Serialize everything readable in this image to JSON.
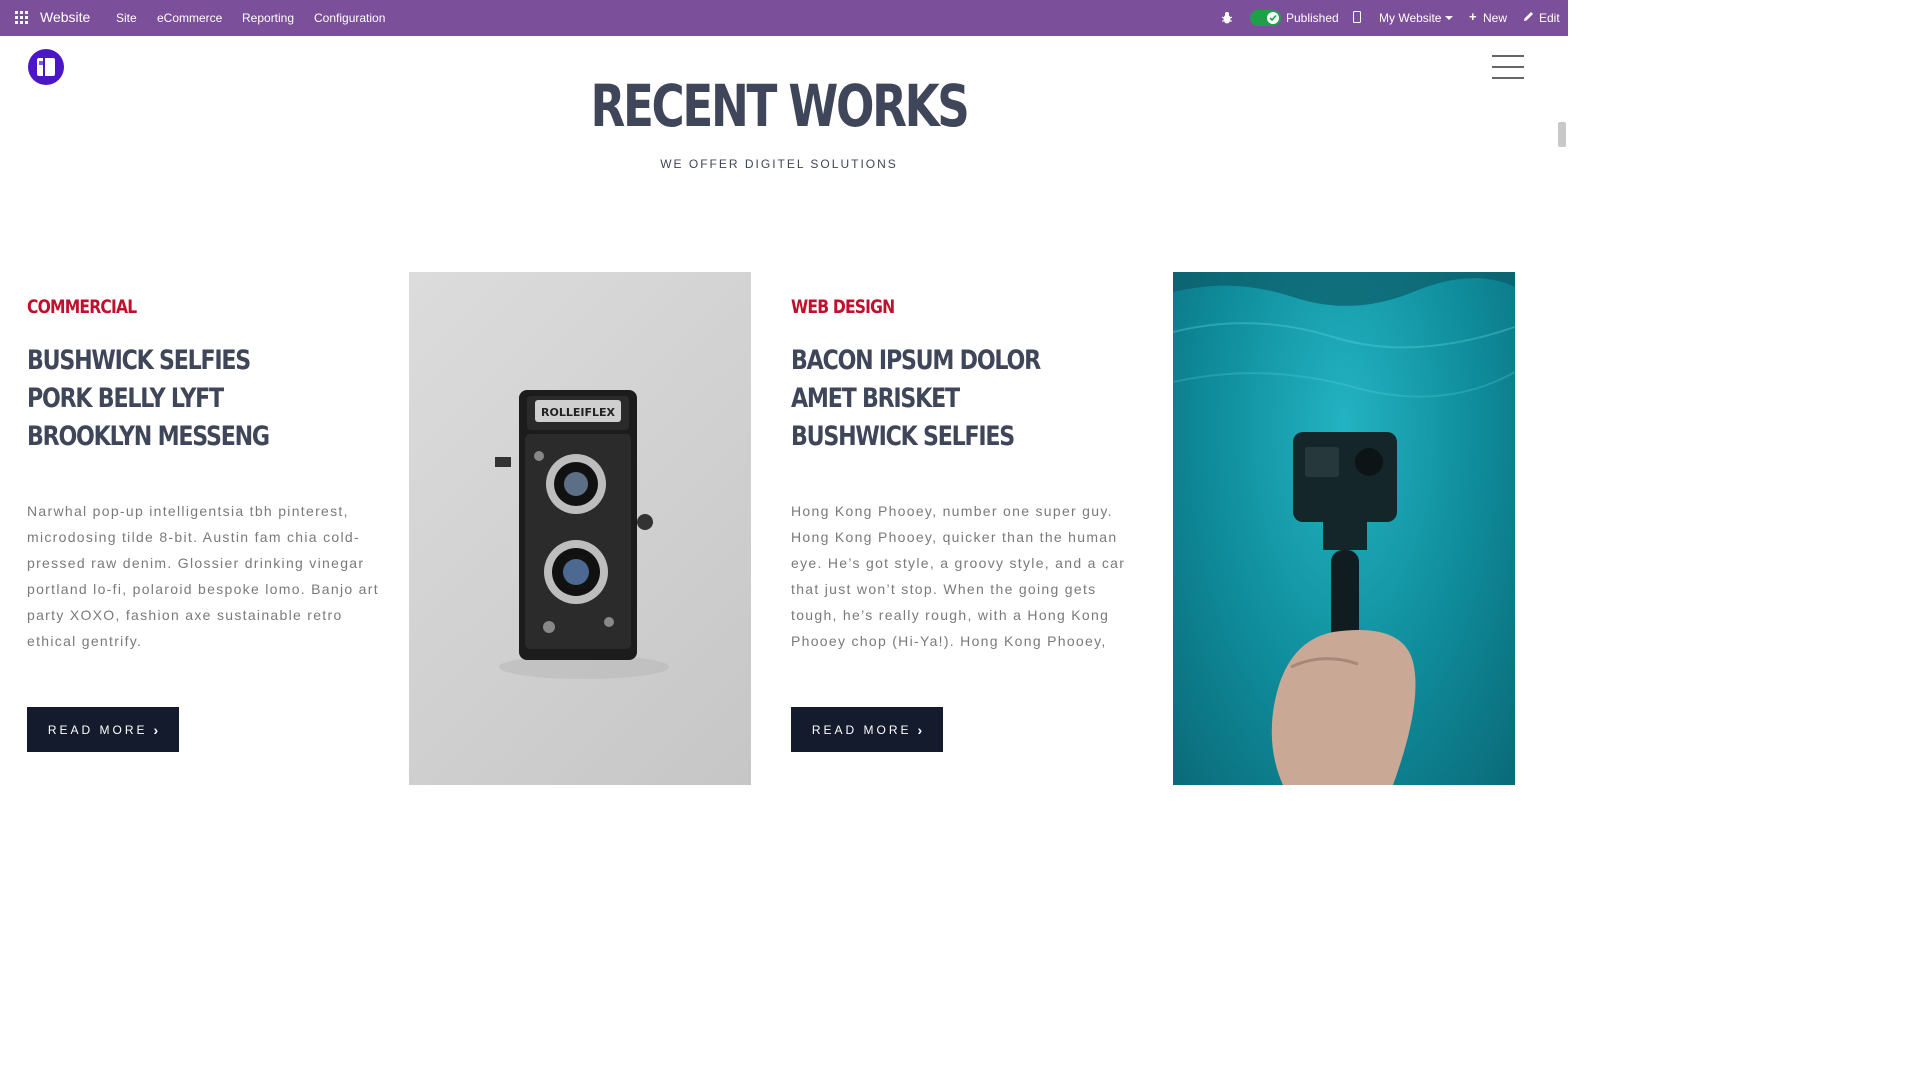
{
  "topbar": {
    "brand": "Website",
    "menu": [
      "Site",
      "eCommerce",
      "Reporting",
      "Configuration"
    ],
    "published_label": "Published",
    "site_selector": "My Website",
    "new_label": "New",
    "edit_label": "Edit",
    "bar_color": "#7c4f9a",
    "toggle_color": "#1f9f4a"
  },
  "section": {
    "title": "RECENT WORKS",
    "subtitle": "WE OFFER DIGITEL SOLUTIONS"
  },
  "works": [
    {
      "category": "COMMERCIAL",
      "heading": [
        "BUSHWICK SELFIES",
        "PORK BELLY LYFT",
        "BROOKLYN MESSENG"
      ],
      "body": "Narwhal pop-up intelligentsia tbh pinterest, microdosing tilde 8-bit. Austin fam chia cold-pressed raw denim. Glossier drinking vinegar portland lo-fi, polaroid bespoke lomo. Banjo art party XOXO, fashion axe sustainable retro ethical gentrify.",
      "button": "READ MORE",
      "image": "vintage-twin-lens-camera",
      "camera_brand": "ROLLEIFLEX"
    },
    {
      "category": "WEB DESIGN",
      "heading": [
        "BACON IPSUM DOLOR",
        "AMET BRISKET",
        "BUSHWICK SELFIES"
      ],
      "body": "Hong Kong Phooey, number one super guy. Hong Kong Phooey, quicker than the human eye. He’s got style, a groovy style, and a car that just won’t stop. When the going gets tough, he’s really rough, with a Hong Kong Phooey chop (Hi-Ya!). Hong Kong Phooey,",
      "button": "READ MORE",
      "image": "underwater-action-camera"
    }
  ],
  "colors": {
    "category": "#c0102d",
    "heading": "#3f4659",
    "button_bg": "#141b2d"
  }
}
